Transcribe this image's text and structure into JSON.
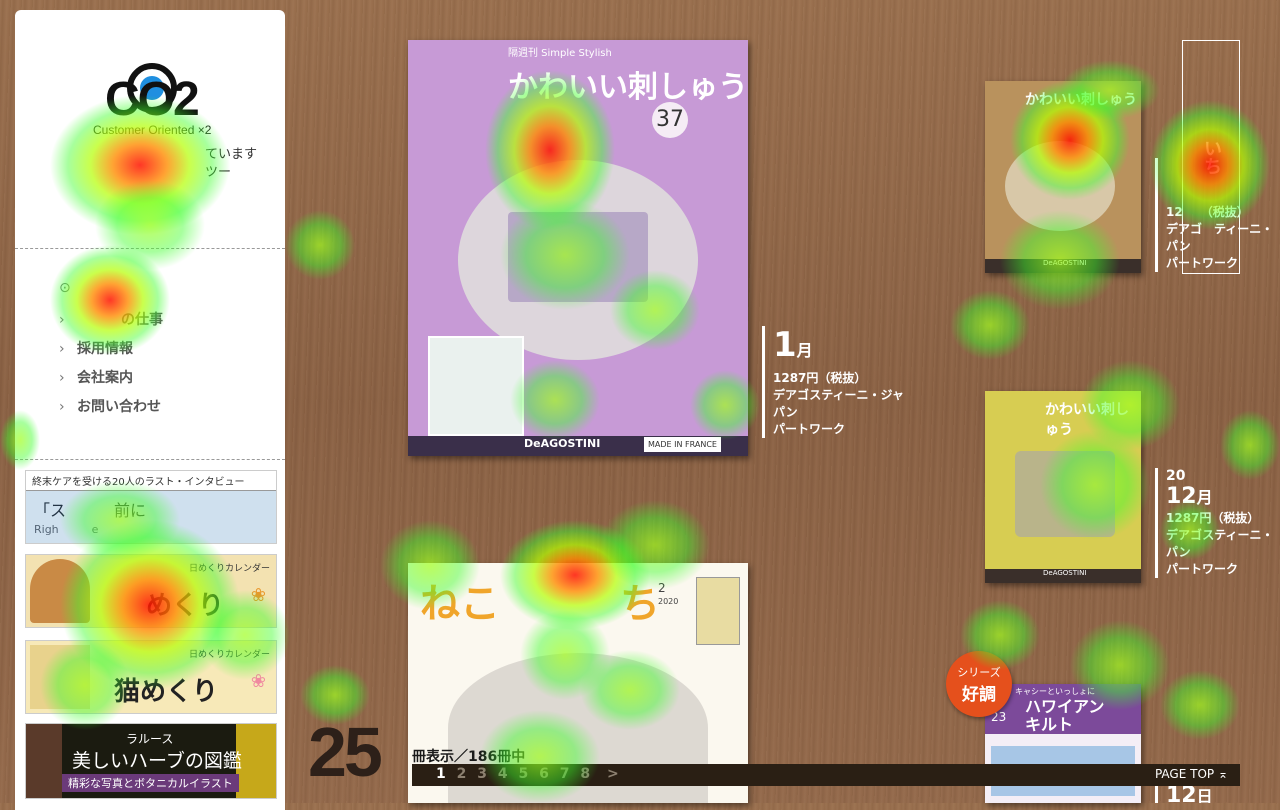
{
  "sidebar": {
    "logo_text": "CO2",
    "logo_sub": "Customer Oriented ×2",
    "tagline": "ています\nツー",
    "nav": [
      {
        "label": ""
      },
      {
        "label": "の仕事"
      },
      {
        "label": "採用情報"
      },
      {
        "label": "会社案内"
      },
      {
        "label": "お問い合わせ"
      }
    ],
    "banners": {
      "interview": {
        "top": "終末ケアを受ける20人のラスト・インタビュー",
        "big": "「ス　　　前に",
        "small": "Righ　　　e"
      },
      "dog": {
        "small": "日めくりカレンダー",
        "big": "めくり"
      },
      "cat": {
        "small": "日めくりカレンダー",
        "big": "猫めくり"
      },
      "herb": {
        "t1": "ラルース",
        "t2": "美しいハーブの図鑑",
        "t3": "精彩な写真とボタニカルイラスト"
      }
    }
  },
  "books": [
    {
      "title": "かわいい刺しゅう",
      "issue": "37",
      "publisher_mark": "DeAGOSTINI",
      "dmc": "MADE IN FRANCE",
      "small": "隔週刊 Simple Stylish"
    },
    {
      "title": "ねこ　　　ち",
      "issue": "2",
      "year": "2020"
    },
    {
      "title": "かわいい刺しゅう",
      "publisher_mark": "DeAGOSTINI"
    },
    {
      "title": "かわいい刺しゅう",
      "publisher_mark": "DeAGOSTINI"
    },
    {
      "title": "ハワイアンキルト",
      "issue": "23",
      "small": "キャシーといっしょに"
    }
  ],
  "book_info": [
    {
      "month_num": "1",
      "month_unit": "月",
      "price": "1287円（税抜）",
      "publisher": "デアゴスティーニ・ジャパン",
      "category": "パートワーク"
    },
    {
      "month_num": "",
      "month_unit": "",
      "price": "12　　（税抜）",
      "publisher": "デアゴ　ティーニ・パン",
      "category": "パートワーク"
    },
    {
      "year": "20",
      "month_num": "12",
      "month_unit": "月",
      "price": "1287円（税抜）",
      "publisher": "デアゴスティーニ・パン",
      "category": "パートワーク"
    },
    {
      "month_num": "12",
      "month_unit": "日",
      "price": "",
      "publisher": "",
      "category": ""
    }
  ],
  "vertical_label": "いち",
  "badge": {
    "line1": "シリーズ",
    "line2": "好調"
  },
  "listing": {
    "count": "25",
    "count_label": "冊表示／186冊中",
    "pages": [
      "1",
      "2",
      "3",
      "4",
      "5",
      "6",
      "7",
      "8"
    ],
    "current_page": "1",
    "next": ">",
    "page_top": "PAGE TOP ⌅"
  },
  "colors": {
    "sidebar_bg": "#ffffff",
    "bar_bg": "#2a1f14",
    "badge": "#e5501c",
    "heat_hot": "#ff1400",
    "heat_cool": "#3cff28"
  }
}
